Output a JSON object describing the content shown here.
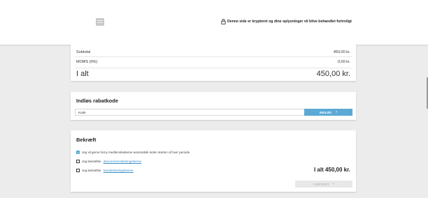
{
  "header": {
    "logo_icon": "image-placeholder-icon",
    "secure_icon": "lock-icon",
    "secure_text": "Denne side er krypteret og dine oplysninger vil blive behandlet fortroligt"
  },
  "summary": {
    "subtotal_label": "Subtotal",
    "subtotal_value": "450,00 kr.",
    "vat_label": "MOMS (0%)",
    "vat_value": "0,00 kr.",
    "total_label": "I alt",
    "total_value": "450,00 kr."
  },
  "discount": {
    "title": "Indløs rabatkode",
    "input_value": "Kode",
    "apply_label": "INDLØS",
    "apply_icon": "chevron-right-icon",
    "accent_color": "#5ba9d6"
  },
  "confirm": {
    "title": "Bekræft",
    "auto_renew": {
      "text": "Jeg vil gerne forny medlemskaberne automatisk inden starten af hver periode",
      "checked": true
    },
    "subscription_terms": {
      "prefix": "Jeg bekræfter",
      "link": "abonnementsbetingelserne",
      "checked": false
    },
    "trade_terms": {
      "prefix": "Jeg bekræfter",
      "link": "handelsbetingelserne",
      "checked": false
    },
    "grand_total": "I alt 450,00 kr.",
    "continue_label": "FORTSÆT",
    "continue_icon": "chevron-right-icon"
  }
}
